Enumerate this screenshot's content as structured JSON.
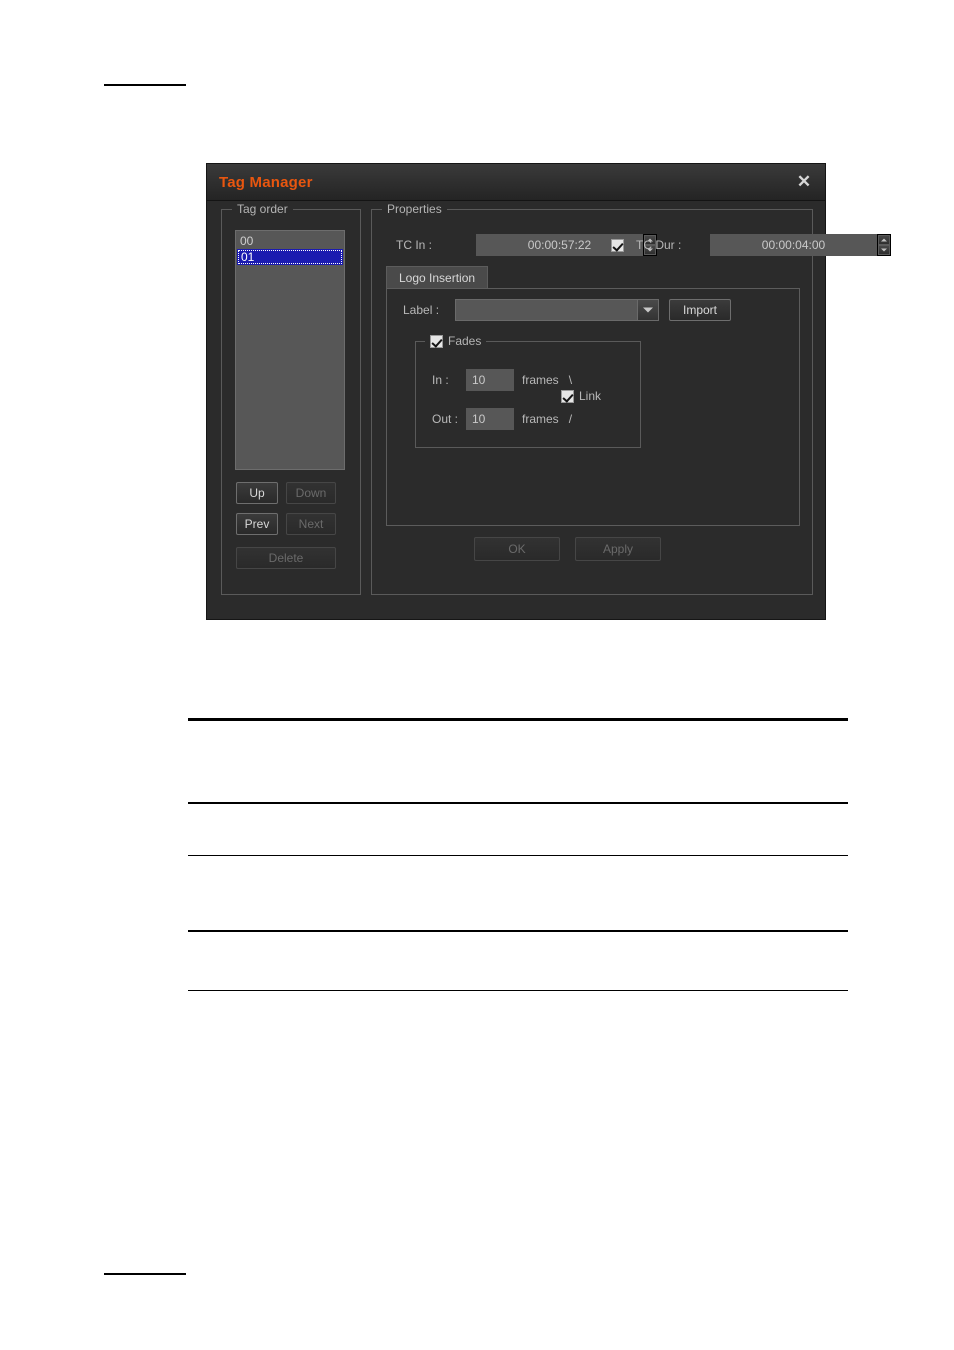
{
  "document": {
    "top_rule": "",
    "bottom_rule": "",
    "table": {
      "rules": [
        "thick",
        "thin",
        "thin",
        "thin",
        "thin"
      ]
    }
  },
  "dialog": {
    "title": "Tag Manager",
    "close_icon": "close-icon",
    "accent_color": "#e8560f",
    "background_color": "#2b2b2b",
    "tag_order": {
      "title": "Tag order",
      "items": [
        {
          "label": "00",
          "selected": false
        },
        {
          "label": "01",
          "selected": true
        }
      ],
      "buttons": {
        "up": "Up",
        "down": "Down",
        "prev": "Prev",
        "next": "Next",
        "delete": "Delete"
      }
    },
    "properties": {
      "title": "Properties",
      "tc_in": {
        "label": "TC In :",
        "value": "00:00:57:22"
      },
      "tc_dur": {
        "label": "TC Dur :",
        "value": "00:00:04:00",
        "checked": true
      },
      "tab": {
        "label": "Logo Insertion"
      },
      "label_field": {
        "label": "Label :",
        "value": "",
        "placeholder": ""
      },
      "import_button": "Import",
      "fades": {
        "title": "Fades",
        "checked": true,
        "in": {
          "label": "In :",
          "value": "10",
          "unit": "frames",
          "mark": "\\"
        },
        "out": {
          "label": "Out :",
          "value": "10",
          "unit": "frames",
          "mark": "/"
        },
        "link": {
          "label": "Link",
          "checked": true
        }
      },
      "ok_button": "OK",
      "apply_button": "Apply"
    }
  }
}
